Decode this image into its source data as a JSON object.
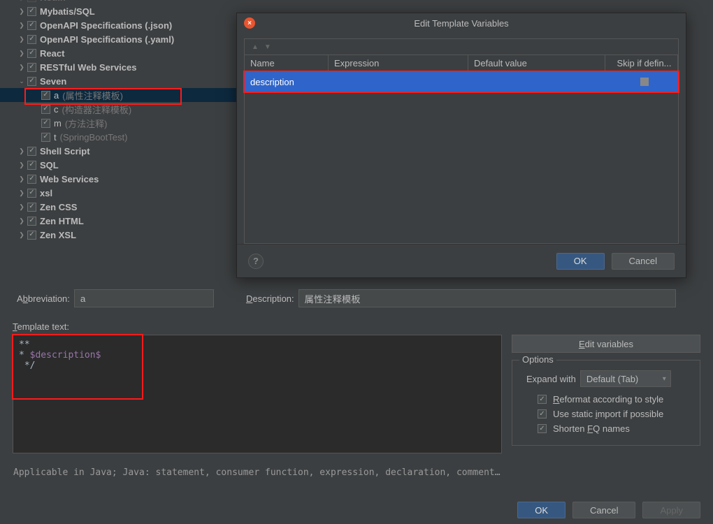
{
  "tree": {
    "items": [
      {
        "depth": 1,
        "exp": ">",
        "checked": true,
        "label": "Kotlin",
        "labelClass": "node-label",
        "faded": true
      },
      {
        "depth": 1,
        "exp": ">",
        "checked": true,
        "label": "Mybatis/SQL",
        "labelClass": "node-label"
      },
      {
        "depth": 1,
        "exp": ">",
        "checked": true,
        "label": "OpenAPI Specifications (.json)",
        "labelClass": "node-label"
      },
      {
        "depth": 1,
        "exp": ">",
        "checked": true,
        "label": "OpenAPI Specifications (.yaml)",
        "labelClass": "node-label"
      },
      {
        "depth": 1,
        "exp": ">",
        "checked": true,
        "label": "React",
        "labelClass": "node-label"
      },
      {
        "depth": 1,
        "exp": ">",
        "checked": true,
        "label": "RESTful Web Services",
        "labelClass": "node-label"
      },
      {
        "depth": 1,
        "exp": "v",
        "checked": true,
        "label": "Seven",
        "labelClass": "node-label"
      },
      {
        "depth": 2,
        "exp": "",
        "checked": true,
        "label": "a",
        "desc": "(属性注释模板)",
        "selected": true,
        "hl": true,
        "thin": true
      },
      {
        "depth": 2,
        "exp": "",
        "checked": true,
        "label": "c",
        "desc": "(构造器注释模板)",
        "thin": true
      },
      {
        "depth": 2,
        "exp": "",
        "checked": true,
        "label": "m",
        "desc": "(方法注释)",
        "thin": true
      },
      {
        "depth": 2,
        "exp": "",
        "checked": true,
        "label": "t",
        "desc": "(SpringBootTest)",
        "thin": true
      },
      {
        "depth": 1,
        "exp": ">",
        "checked": true,
        "label": "Shell Script",
        "labelClass": "node-label"
      },
      {
        "depth": 1,
        "exp": ">",
        "checked": true,
        "label": "SQL",
        "labelClass": "node-label"
      },
      {
        "depth": 1,
        "exp": ">",
        "checked": true,
        "label": "Web Services",
        "labelClass": "node-label"
      },
      {
        "depth": 1,
        "exp": ">",
        "checked": true,
        "label": "xsl",
        "labelClass": "node-label"
      },
      {
        "depth": 1,
        "exp": ">",
        "checked": true,
        "label": "Zen CSS",
        "labelClass": "node-label"
      },
      {
        "depth": 1,
        "exp": ">",
        "checked": true,
        "label": "Zen HTML",
        "labelClass": "node-label"
      },
      {
        "depth": 1,
        "exp": ">",
        "checked": true,
        "label": "Zen XSL",
        "labelClass": "node-label"
      }
    ]
  },
  "modal": {
    "title": "Edit Template Variables",
    "close_glyph": "×",
    "arrow_up": "▲",
    "arrow_down": "▼",
    "columns": {
      "name": "Name",
      "expr": "Expression",
      "def": "Default value",
      "skip": "Skip if defin..."
    },
    "row": {
      "name": "description",
      "expr": "",
      "def": "",
      "skip": false
    },
    "help": "?",
    "ok": "OK",
    "cancel": "Cancel"
  },
  "form": {
    "abbr_label_pre": "A",
    "abbr_label_u": "b",
    "abbr_label_post": "breviation:",
    "abbr_value": "a",
    "desc_label_pre": "",
    "desc_label_u": "D",
    "desc_label_post": "escription:",
    "desc_value": "属性注释模板",
    "template_label_pre": "",
    "template_label_u": "T",
    "template_label_post": "emplate text:",
    "template_lines": [
      "**",
      " * $description$",
      " */"
    ],
    "edit_vars_pre": "",
    "edit_vars_u": "E",
    "edit_vars_post": "dit variables",
    "options_title": "Options",
    "expand_label": "Expand with",
    "expand_value": "Default (Tab)",
    "opt1_pre": "",
    "opt1_u": "R",
    "opt1_post": "eformat according to style",
    "opt2_pre": "Use static ",
    "opt2_u": "i",
    "opt2_post": "mport if possible",
    "opt3_pre": "Shorten ",
    "opt3_u": "F",
    "opt3_post": "Q names",
    "applicable": "Applicable in Java; Java: statement, consumer function, expression, declaration, comment, string, t..."
  },
  "footer": {
    "ok": "OK",
    "cancel": "Cancel",
    "apply": "Apply"
  }
}
